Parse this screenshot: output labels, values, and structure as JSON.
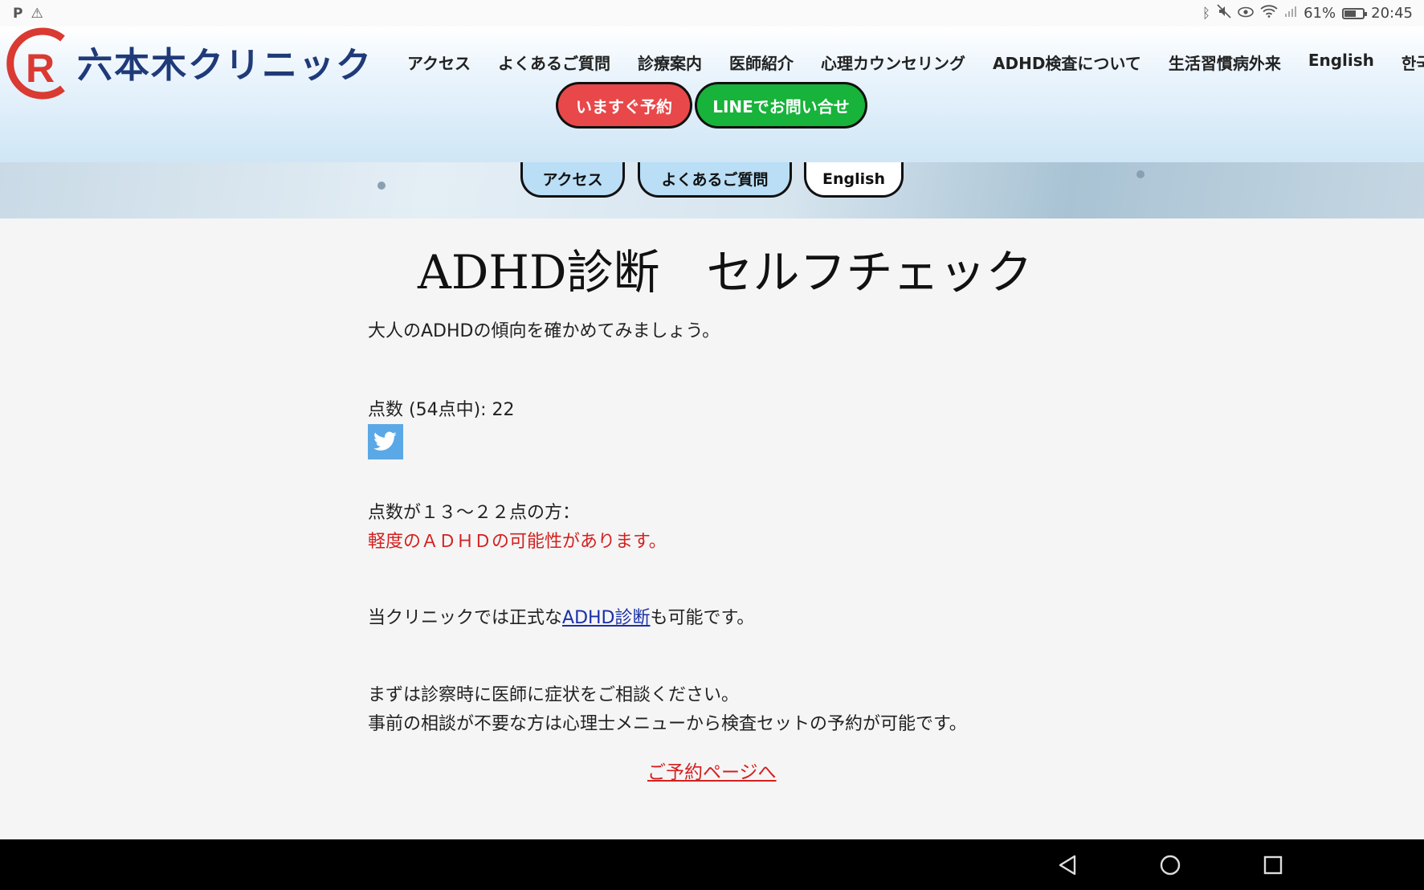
{
  "status_bar": {
    "left_icons": [
      "p-icon",
      "warning-icon"
    ],
    "battery": "61%",
    "battery_fraction": 0.61,
    "time": "20:45"
  },
  "header": {
    "logo_text": "六本木クリニック",
    "nav": [
      "アクセス",
      "よくあるご質問",
      "診療案内",
      "医師紹介",
      "心理カウンセリング",
      "ADHD検査について",
      "生活習慣病外来",
      "English",
      "한국어"
    ],
    "cta_reserve": "いますぐ予約",
    "cta_line": "LINEでお問い合せ",
    "colors": {
      "logo_blue": "#1f3a78",
      "logo_red": "#d93a32",
      "reserve_red": "#e8484a",
      "line_green": "#17b33a"
    }
  },
  "banner": {
    "pills": [
      "アクセス",
      "よくあるご質問",
      "English"
    ]
  },
  "main": {
    "title": "ADHD診断　セルフチェック",
    "intro": "大人のADHDの傾向を確かめてみましょう。",
    "score": "点数 (54点中): 22",
    "range_text": "点数が１３～２２点の方：",
    "result_text": "軽度のＡＤＨＤの可能性があります。",
    "clinic_prefix": "当クリニックでは正式な",
    "clinic_link": "ADHD診断",
    "clinic_suffix": "も可能です。",
    "consult_1": "まずは診察時に医師に症状をご相談ください。",
    "consult_2": "事前の相談が不要な方は心理士メニューから検査セットの予約が可能です。",
    "reserve_link": "ご予約ページへ"
  },
  "nav_bar": {
    "buttons": [
      "back-icon",
      "home-icon",
      "recents-icon"
    ]
  }
}
